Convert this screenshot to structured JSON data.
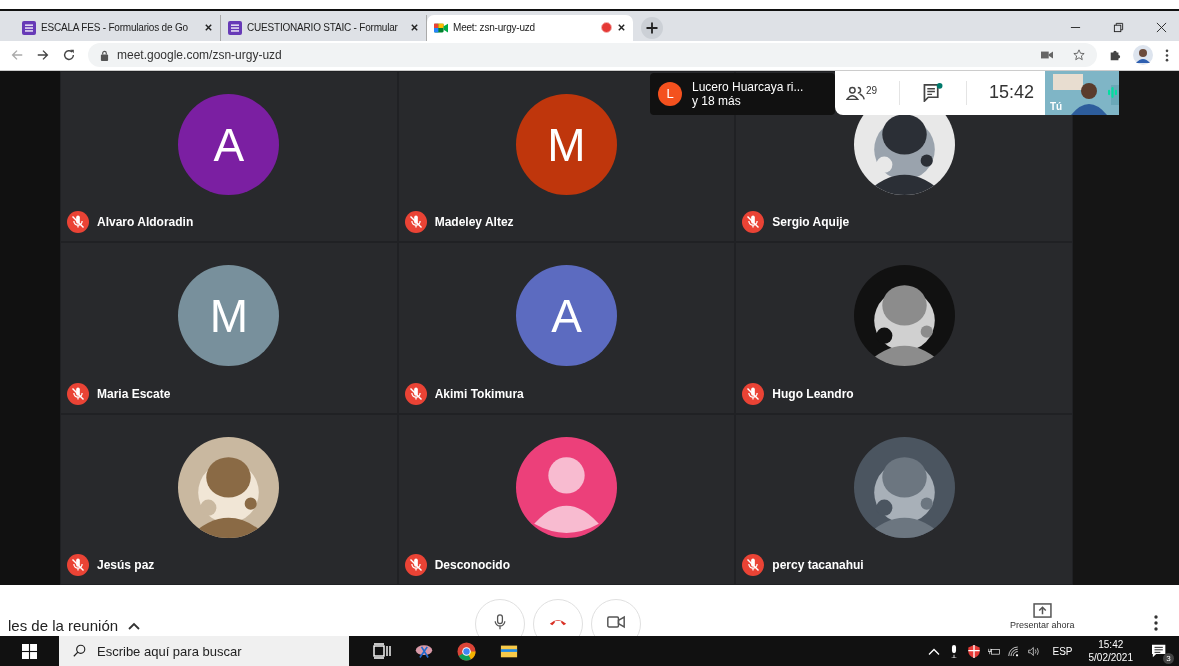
{
  "browser": {
    "tabs": [
      {
        "title": "ESCALA FES - Formularios de Go",
        "kind": "forms",
        "selected": false,
        "recording": false
      },
      {
        "title": "CUESTIONARIO STAIC - Formular",
        "kind": "forms",
        "selected": false,
        "recording": false
      },
      {
        "title": "Meet: zsn-urgy-uzd",
        "kind": "meet",
        "selected": true,
        "recording": true
      }
    ],
    "url": "meet.google.com/zsn-urgy-uzd"
  },
  "notification": {
    "initial": "L",
    "title": "Lucero Huarcaya ri...",
    "subtitle": "y 18 más"
  },
  "meeting_info": {
    "people_count": "29",
    "unread_chat": true,
    "time": "15:42",
    "self_label": "Tú"
  },
  "participants": [
    {
      "name": "Alvaro Aldoradin",
      "kind": "letter",
      "initial": "A",
      "color": "#7b1fa2",
      "muted": true
    },
    {
      "name": "Madeley Altez",
      "kind": "letter",
      "initial": "M",
      "color": "#bf360c",
      "muted": true
    },
    {
      "name": "Sergio Aquije",
      "kind": "picture",
      "muted": true
    },
    {
      "name": "Maria Escate",
      "kind": "letter",
      "initial": "M",
      "color": "#78909c",
      "muted": true
    },
    {
      "name": "Akimi Tokimura",
      "kind": "letter",
      "initial": "A",
      "color": "#5c6bc0",
      "muted": true
    },
    {
      "name": "Hugo Leandro",
      "kind": "picture",
      "muted": true
    },
    {
      "name": "Jesús paz",
      "kind": "picture",
      "muted": true
    },
    {
      "name": "Desconocido",
      "kind": "silhouette",
      "color": "#ec407a",
      "muted": true
    },
    {
      "name": "percy tacanahui",
      "kind": "picture",
      "muted": true
    }
  ],
  "bottom_bar": {
    "details": "les de la reunión",
    "present": "Presentar ahora"
  },
  "taskbar": {
    "search_placeholder": "Escribe aquí para buscar",
    "language": "ESP",
    "time": "15:42",
    "date": "5/02/2021",
    "notifications": "3"
  }
}
